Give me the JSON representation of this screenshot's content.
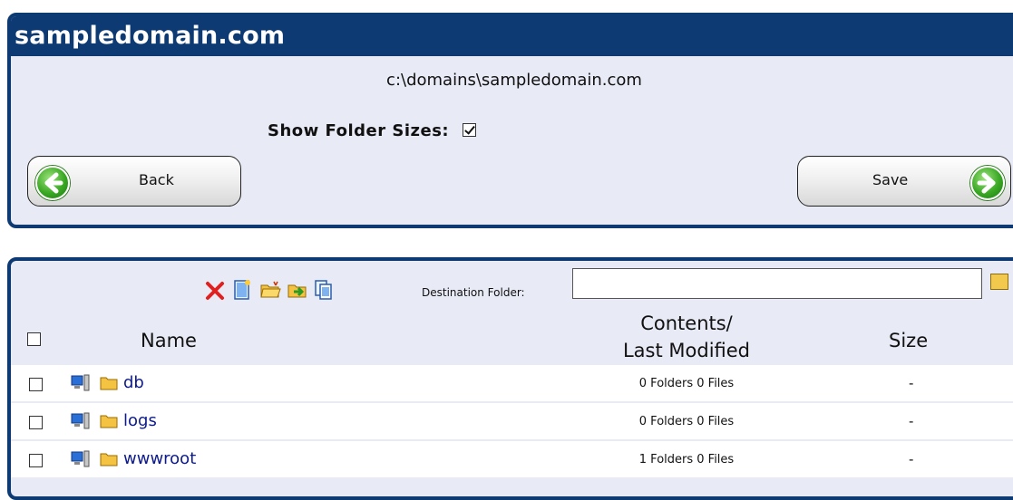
{
  "site": {
    "title": "sampledomain.com",
    "path": "c:\\domains\\sampledomain.com",
    "show_folder_sizes_label": "Show Folder Sizes:",
    "show_folder_sizes_checked": true,
    "back_label": "Back",
    "save_label": "Save"
  },
  "toolbar": {
    "icons": [
      "delete-icon",
      "new-file-icon",
      "new-folder-icon",
      "move-icon",
      "copy-icon"
    ],
    "destination_label": "Destination Folder:",
    "destination_value": ""
  },
  "table": {
    "headers": {
      "name": "Name",
      "contents_line1": "Contents/",
      "contents_line2": "Last Modified",
      "size": "Size"
    },
    "rows": [
      {
        "name": "db",
        "contents": "0 Folders 0 Files",
        "size": "-"
      },
      {
        "name": "logs",
        "contents": "0 Folders 0 Files",
        "size": "-"
      },
      {
        "name": "wwwroot",
        "contents": "1 Folders 0 Files",
        "size": "-"
      }
    ]
  },
  "colors": {
    "header_blue": "#0d3a73",
    "panel_bg": "#e8eaf6",
    "link": "#0d1a8a",
    "arrow_green": "#3aa824"
  }
}
